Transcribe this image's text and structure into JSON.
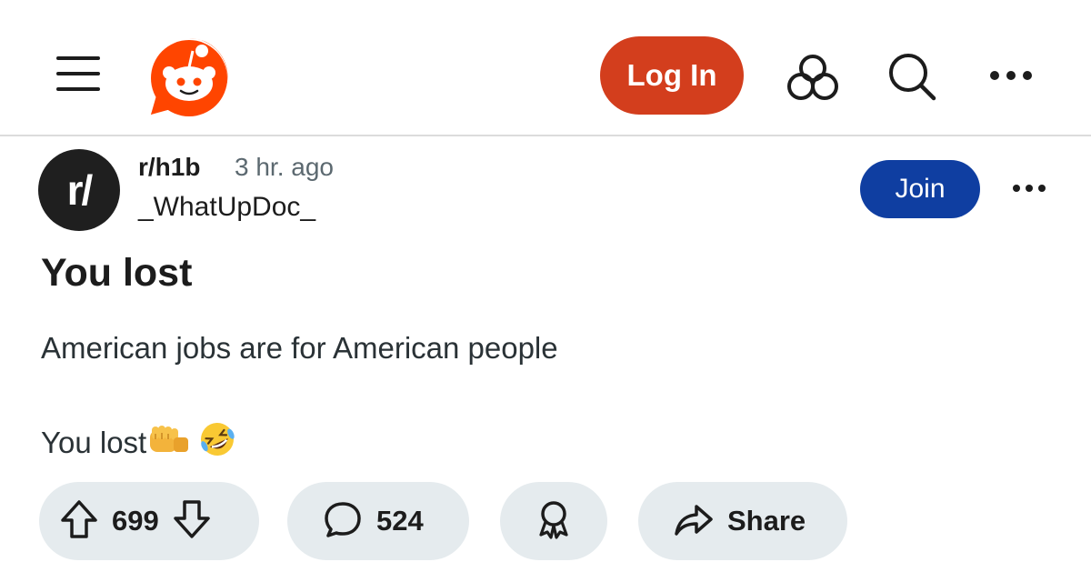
{
  "header": {
    "login_label": "Log In",
    "icons": [
      "menu-icon",
      "reddit-logo",
      "advertise-icon",
      "search-icon",
      "more-icon"
    ]
  },
  "post": {
    "subreddit_avatar_text": "r/",
    "subreddit": "r/h1b",
    "time": "3 hr. ago",
    "author": "_WhatUpDoc_",
    "join_label": "Join",
    "title": "You lost",
    "body_line_1": "American jobs are for American people",
    "body_line_2": "You lost"
  },
  "actions": {
    "votes": "699",
    "comments": "524",
    "share_label": "Share"
  },
  "colors": {
    "brand_orange": "#d33e1d",
    "logo_orange": "#ff4500",
    "join_blue": "#0f3ea1",
    "pill_gray": "#e5ebee"
  }
}
